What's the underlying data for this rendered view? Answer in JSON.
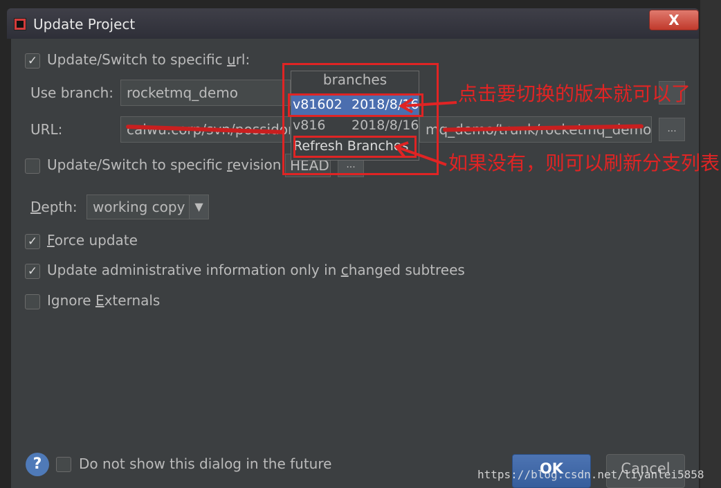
{
  "window": {
    "title": "Update Project",
    "close_glyph": "X"
  },
  "update_url": {
    "checked": true,
    "label_before": "Update/Switch to specific ",
    "label_mnemonic": "u",
    "label_after": "rl:"
  },
  "branch": {
    "label": "Use branch:",
    "value": "rocketmq_demo"
  },
  "url": {
    "label": "URL:",
    "value_left": "caiwu.corp/svn/possidon",
    "value_right": "mq_demo/trunk/rocketmq_demo",
    "browse_label": "..."
  },
  "revision": {
    "checked": false,
    "label_before": "Update/Switch to specific ",
    "label_mnemonic": "r",
    "label_after": "evision:",
    "value": "HEAD",
    "browse_label": "..."
  },
  "depth": {
    "label_mnemonic": "D",
    "label_after": "epth:",
    "value": "working copy",
    "arrow_glyph": "▼"
  },
  "options": [
    {
      "checked": true,
      "mnemonic": "F",
      "rest": "orce update",
      "before": ""
    },
    {
      "checked": true,
      "before": "Update administrative information only in ",
      "mnemonic": "c",
      "rest": "hanged subtrees"
    },
    {
      "checked": false,
      "before": "Ignore ",
      "mnemonic": "E",
      "rest": "xternals"
    }
  ],
  "branches_popup": {
    "title": "branches",
    "items": [
      {
        "name": "v81602",
        "date": "2018/8/16",
        "selected": true
      },
      {
        "name": "v816",
        "date": "2018/8/16",
        "selected": false
      }
    ],
    "refresh_label": "Refresh Branches"
  },
  "annotations": {
    "click_note": "点击要切换的版本就可以了",
    "refresh_note": "如果没有，则可以刷新分支列表",
    "color": "#e02424"
  },
  "footer": {
    "help_glyph": "?",
    "dont_show_label": "Do not show this dialog in the future",
    "dont_show_checked": false,
    "ok_label": "OK",
    "cancel_label": "Cancel"
  },
  "watermark": "https://blog.csdn.net/liyanlei5858",
  "colors": {
    "selection": "#4b6eaf",
    "accent_blue": "#365e9c",
    "dialog_bg": "#3c3f41"
  }
}
